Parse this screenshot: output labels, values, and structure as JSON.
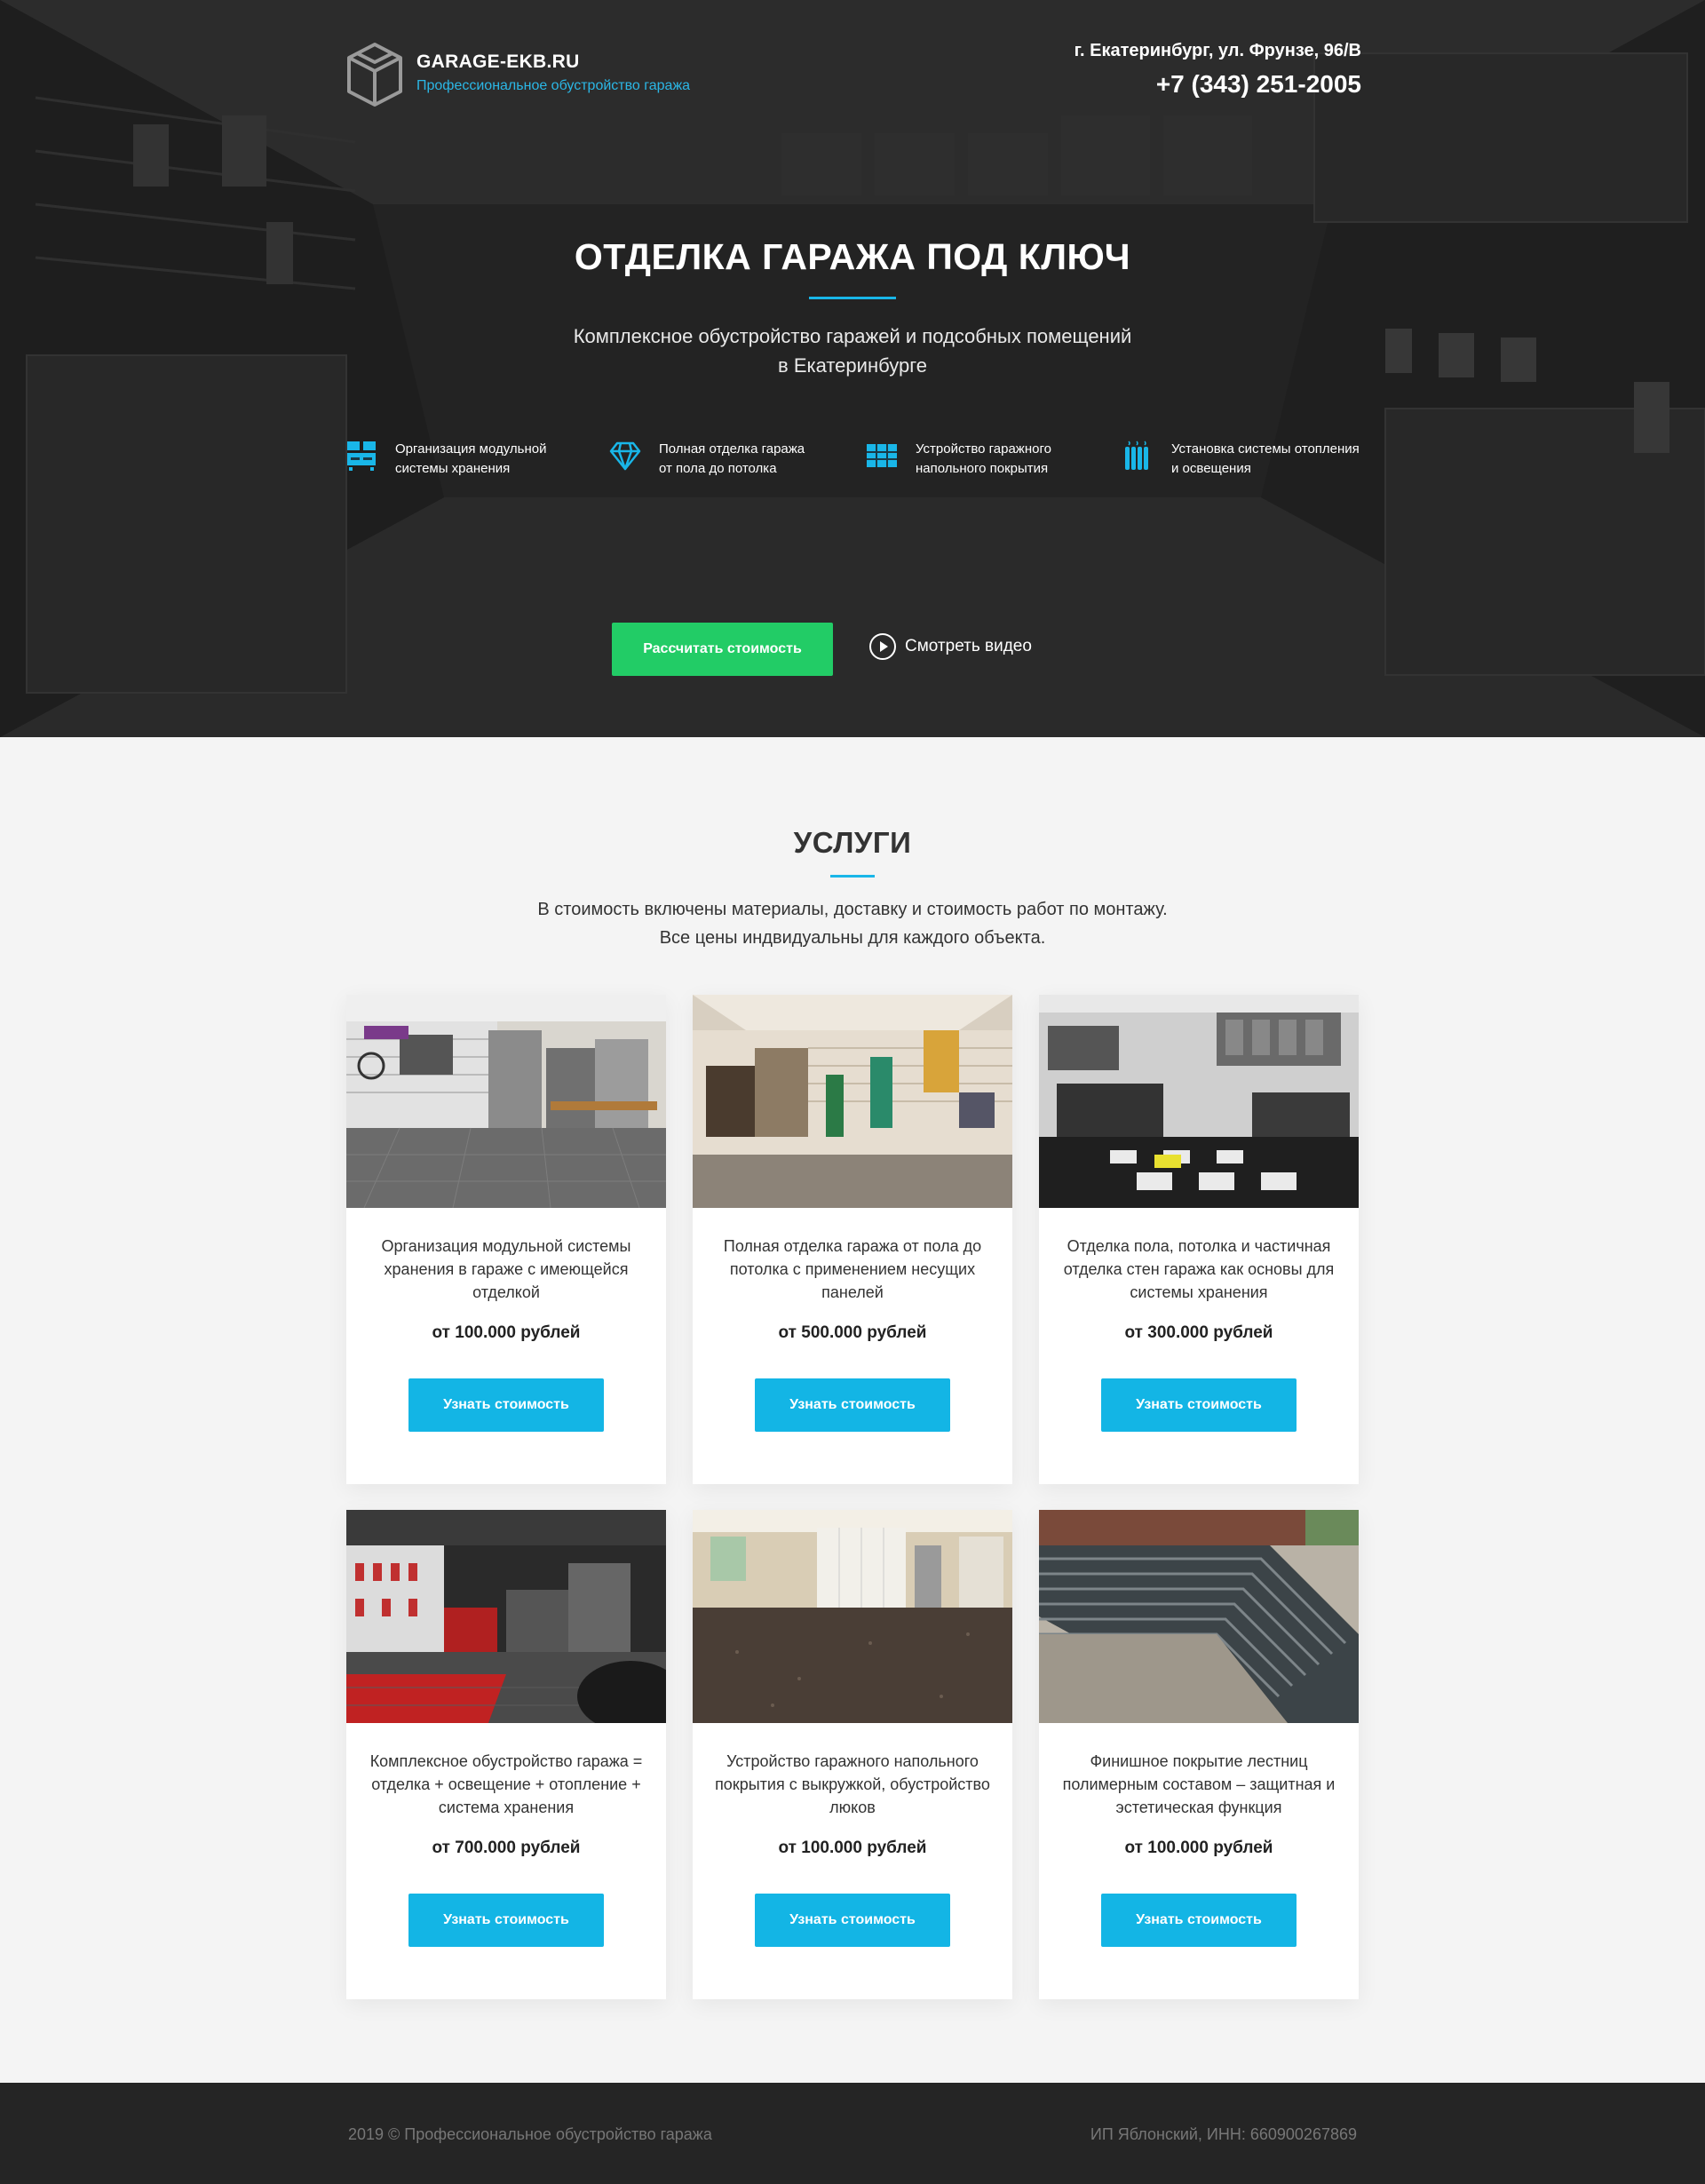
{
  "header": {
    "logo_title": "GARAGE-EKB.RU",
    "logo_subtitle": "Профессиональное обустройство гаража",
    "address": "г. Екатеринбург, ул. Фрунзе, 96/В",
    "phone": "+7 (343) 251-2005"
  },
  "hero": {
    "title": "ОТДЕЛКА ГАРАЖА ПОД КЛЮЧ",
    "subtitle_line1": "Комплексное обустройство гаражей и подсобных помещений",
    "subtitle_line2": "в Екатеринбурге",
    "features": [
      {
        "icon": "storage-icon",
        "text": "Организация модульной\nсистемы хранения"
      },
      {
        "icon": "diamond-icon",
        "text": "Полная отделка гаража\nот пола до потолка"
      },
      {
        "icon": "floor-tiles-icon",
        "text": "Устройство гаражного\nнапольного покрытия"
      },
      {
        "icon": "radiator-icon",
        "text": "Установка системы отопления\nи освещения"
      }
    ],
    "cta_label": "Рассчитать стоимость",
    "video_label": "Смотреть видео"
  },
  "services": {
    "title": "УСЛУГИ",
    "subtitle_line1": "В стоимость включены материалы, доставку и стоимость работ по монтажу.",
    "subtitle_line2": "Все цены индвидуальны для каждого объекта.",
    "cards": [
      {
        "text": "Организация модульной системы хранения в гараже с имеющейся отделкой",
        "price": "от 100.000 рублей",
        "button": "Узнать стоимость"
      },
      {
        "text": "Полная отделка гаража от пола до потолка с применением несущих панелей",
        "price": "от 500.000 рублей",
        "button": "Узнать стоимость"
      },
      {
        "text": "Отделка пола, потолка и частичная отделка стен гаража как основы для системы хранения",
        "price": "от 300.000 рублей",
        "button": "Узнать стоимость"
      },
      {
        "text": "Комплексное обустройство гаража = отделка + освещение + отопление + система хранения",
        "price": "от 700.000 рублей",
        "button": "Узнать стоимость"
      },
      {
        "text": "Устройство гаражного напольного покрытия с выкружкой, обустройство люков",
        "price": "от 100.000 рублей",
        "button": "Узнать стоимость"
      },
      {
        "text": "Финишное покрытие лестниц полимерным составом – защитная и эстетическая функция",
        "price": "от 100.000 рублей",
        "button": "Узнать стоимость"
      }
    ]
  },
  "footer": {
    "copyright": "2019 © Профессиональное обустройство гаража",
    "legal": "ИП Яблонский, ИНН: 660900267869"
  },
  "colors": {
    "accent": "#13b5e5",
    "cta_green": "#22cc66",
    "footer_bg": "#252525"
  }
}
